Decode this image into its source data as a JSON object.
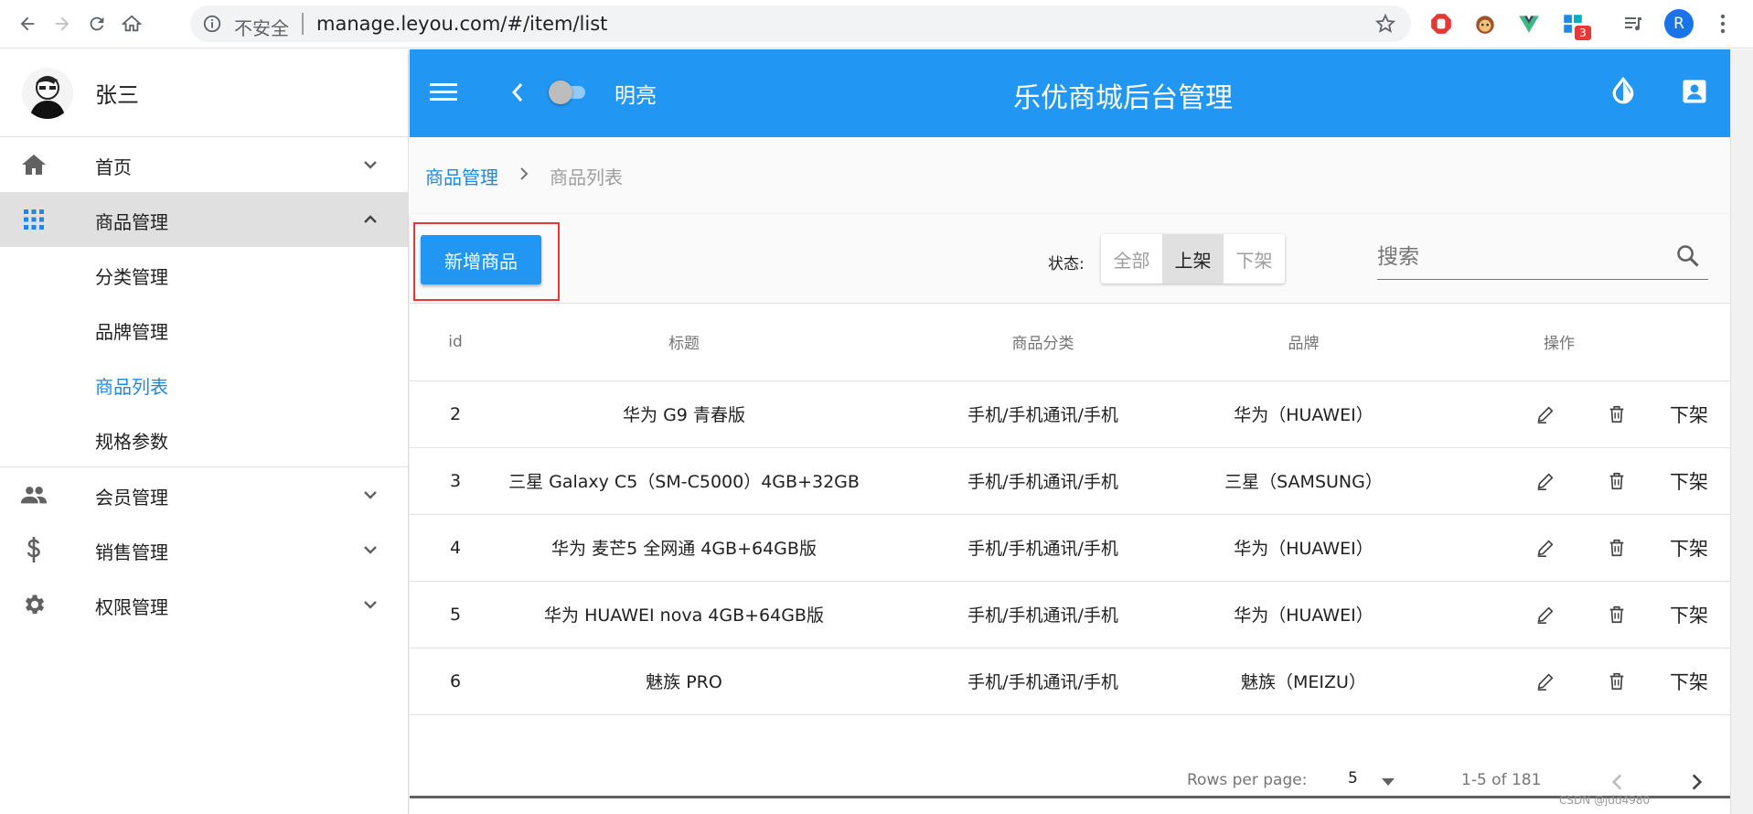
{
  "browser": {
    "insecure_label": "不安全",
    "url": "manage.leyou.com/#/item/list",
    "ext_badge": "3",
    "profile_initial": "R"
  },
  "sidebar": {
    "user_name": "张三",
    "items": [
      {
        "label": "首页",
        "icon": "home-icon"
      },
      {
        "label": "商品管理",
        "icon": "apps-grid-icon"
      },
      {
        "label": "会员管理",
        "icon": "people-icon"
      },
      {
        "label": "销售管理",
        "icon": "dollar-icon"
      },
      {
        "label": "权限管理",
        "icon": "gear-icon"
      }
    ],
    "sub_items": [
      "分类管理",
      "品牌管理",
      "商品列表",
      "规格参数"
    ]
  },
  "toolbar": {
    "toggle_label": "明亮",
    "title": "乐优商城后台管理"
  },
  "breadcrumb": {
    "parent": "商品管理",
    "current": "商品列表"
  },
  "actions": {
    "add_label": "新增商品",
    "status_label": "状态:",
    "filters": [
      "全部",
      "上架",
      "下架"
    ],
    "selected_filter": "上架",
    "search_placeholder": "搜索"
  },
  "table": {
    "headers": [
      "id",
      "标题",
      "商品分类",
      "品牌",
      "操作"
    ],
    "rows": [
      {
        "id": "2",
        "title": "华为 G9 青春版",
        "category": "手机/手机通讯/手机",
        "brand": "华为（HUAWEI）",
        "action": "下架"
      },
      {
        "id": "3",
        "title": "三星 Galaxy C5（SM-C5000）4GB+32GB",
        "category": "手机/手机通讯/手机",
        "brand": "三星（SAMSUNG）",
        "action": "下架"
      },
      {
        "id": "4",
        "title": "华为 麦芒5 全网通 4GB+64GB版",
        "category": "手机/手机通讯/手机",
        "brand": "华为（HUAWEI）",
        "action": "下架"
      },
      {
        "id": "5",
        "title": "华为 HUAWEI nova 4GB+64GB版",
        "category": "手机/手机通讯/手机",
        "brand": "华为（HUAWEI）",
        "action": "下架"
      },
      {
        "id": "6",
        "title": "魅族 PRO",
        "category": "手机/手机通讯/手机",
        "brand": "魅族（MEIZU）",
        "action": "下架"
      }
    ]
  },
  "pagination": {
    "rows_per_page_label": "Rows per page:",
    "rows_per_page": "5",
    "range": "1-5 of 181"
  },
  "watermark": "CSDN @jdd4980",
  "colors": {
    "primary": "#2196f3",
    "link": "#1e88e5",
    "highlight": "#e53935"
  }
}
